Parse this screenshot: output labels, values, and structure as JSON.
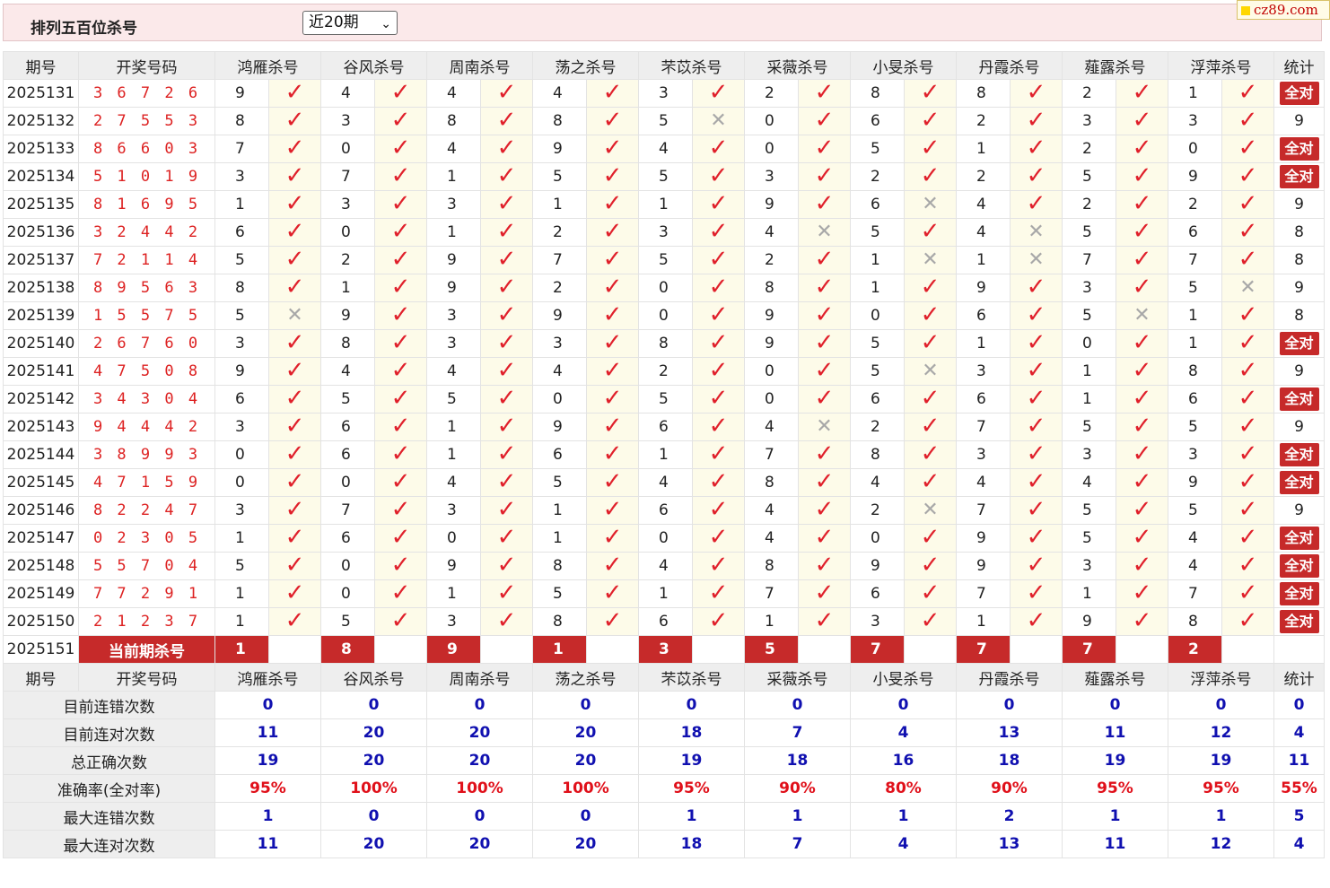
{
  "header": {
    "title": "排列五百位杀号",
    "select_value": "近20期",
    "site": "cz89.com"
  },
  "columns": {
    "issue": "期号",
    "draw": "开奖号码",
    "experts": [
      "鸿雁杀号",
      "谷风杀号",
      "周南杀号",
      "荡之杀号",
      "芣苡杀号",
      "采薇杀号",
      "小旻杀号",
      "丹霞杀号",
      "薤露杀号",
      "浮萍杀号"
    ],
    "stat": "统计"
  },
  "rows": [
    {
      "issue": "2025131",
      "draw": "3 6 7 2 6",
      "kills": [
        9,
        4,
        4,
        4,
        3,
        2,
        8,
        8,
        2,
        1
      ],
      "hits": [
        1,
        1,
        1,
        1,
        1,
        1,
        1,
        1,
        1,
        1
      ],
      "stat": "全对"
    },
    {
      "issue": "2025132",
      "draw": "2 7 5 5 3",
      "kills": [
        8,
        3,
        8,
        8,
        5,
        0,
        6,
        2,
        3,
        3
      ],
      "hits": [
        1,
        1,
        1,
        1,
        0,
        1,
        1,
        1,
        1,
        1
      ],
      "stat": "9"
    },
    {
      "issue": "2025133",
      "draw": "8 6 6 0 3",
      "kills": [
        7,
        0,
        4,
        9,
        4,
        0,
        5,
        1,
        2,
        0
      ],
      "hits": [
        1,
        1,
        1,
        1,
        1,
        1,
        1,
        1,
        1,
        1
      ],
      "stat": "全对"
    },
    {
      "issue": "2025134",
      "draw": "5 1 0 1 9",
      "kills": [
        3,
        7,
        1,
        5,
        5,
        3,
        2,
        2,
        5,
        9
      ],
      "hits": [
        1,
        1,
        1,
        1,
        1,
        1,
        1,
        1,
        1,
        1
      ],
      "stat": "全对"
    },
    {
      "issue": "2025135",
      "draw": "8 1 6 9 5",
      "kills": [
        1,
        3,
        3,
        1,
        1,
        9,
        6,
        4,
        2,
        2
      ],
      "hits": [
        1,
        1,
        1,
        1,
        1,
        1,
        0,
        1,
        1,
        1
      ],
      "stat": "9"
    },
    {
      "issue": "2025136",
      "draw": "3 2 4 4 2",
      "kills": [
        6,
        0,
        1,
        2,
        3,
        4,
        5,
        4,
        5,
        6
      ],
      "hits": [
        1,
        1,
        1,
        1,
        1,
        0,
        1,
        0,
        1,
        1
      ],
      "stat": "8"
    },
    {
      "issue": "2025137",
      "draw": "7 2 1 1 4",
      "kills": [
        5,
        2,
        9,
        7,
        5,
        2,
        1,
        1,
        7,
        7
      ],
      "hits": [
        1,
        1,
        1,
        1,
        1,
        1,
        0,
        0,
        1,
        1
      ],
      "stat": "8"
    },
    {
      "issue": "2025138",
      "draw": "8 9 5 6 3",
      "kills": [
        8,
        1,
        9,
        2,
        0,
        8,
        1,
        9,
        3,
        5
      ],
      "hits": [
        1,
        1,
        1,
        1,
        1,
        1,
        1,
        1,
        1,
        0
      ],
      "stat": "9"
    },
    {
      "issue": "2025139",
      "draw": "1 5 5 7 5",
      "kills": [
        5,
        9,
        3,
        9,
        0,
        9,
        0,
        6,
        5,
        1
      ],
      "hits": [
        0,
        1,
        1,
        1,
        1,
        1,
        1,
        1,
        0,
        1
      ],
      "stat": "8"
    },
    {
      "issue": "2025140",
      "draw": "2 6 7 6 0",
      "kills": [
        3,
        8,
        3,
        3,
        8,
        9,
        5,
        1,
        0,
        1
      ],
      "hits": [
        1,
        1,
        1,
        1,
        1,
        1,
        1,
        1,
        1,
        1
      ],
      "stat": "全对"
    },
    {
      "issue": "2025141",
      "draw": "4 7 5 0 8",
      "kills": [
        9,
        4,
        4,
        4,
        2,
        0,
        5,
        3,
        1,
        8
      ],
      "hits": [
        1,
        1,
        1,
        1,
        1,
        1,
        0,
        1,
        1,
        1
      ],
      "stat": "9"
    },
    {
      "issue": "2025142",
      "draw": "3 4 3 0 4",
      "kills": [
        6,
        5,
        5,
        0,
        5,
        0,
        6,
        6,
        1,
        6
      ],
      "hits": [
        1,
        1,
        1,
        1,
        1,
        1,
        1,
        1,
        1,
        1
      ],
      "stat": "全对"
    },
    {
      "issue": "2025143",
      "draw": "9 4 4 4 2",
      "kills": [
        3,
        6,
        1,
        9,
        6,
        4,
        2,
        7,
        5,
        5
      ],
      "hits": [
        1,
        1,
        1,
        1,
        1,
        0,
        1,
        1,
        1,
        1
      ],
      "stat": "9"
    },
    {
      "issue": "2025144",
      "draw": "3 8 9 9 3",
      "kills": [
        0,
        6,
        1,
        6,
        1,
        7,
        8,
        3,
        3,
        3
      ],
      "hits": [
        1,
        1,
        1,
        1,
        1,
        1,
        1,
        1,
        1,
        1
      ],
      "stat": "全对"
    },
    {
      "issue": "2025145",
      "draw": "4 7 1 5 9",
      "kills": [
        0,
        0,
        4,
        5,
        4,
        8,
        4,
        4,
        4,
        9
      ],
      "hits": [
        1,
        1,
        1,
        1,
        1,
        1,
        1,
        1,
        1,
        1
      ],
      "stat": "全对"
    },
    {
      "issue": "2025146",
      "draw": "8 2 2 4 7",
      "kills": [
        3,
        7,
        3,
        1,
        6,
        4,
        2,
        7,
        5,
        5
      ],
      "hits": [
        1,
        1,
        1,
        1,
        1,
        1,
        0,
        1,
        1,
        1
      ],
      "stat": "9"
    },
    {
      "issue": "2025147",
      "draw": "0 2 3 0 5",
      "kills": [
        1,
        6,
        0,
        1,
        0,
        4,
        0,
        9,
        5,
        4
      ],
      "hits": [
        1,
        1,
        1,
        1,
        1,
        1,
        1,
        1,
        1,
        1
      ],
      "stat": "全对"
    },
    {
      "issue": "2025148",
      "draw": "5 5 7 0 4",
      "kills": [
        5,
        0,
        9,
        8,
        4,
        8,
        9,
        9,
        3,
        4
      ],
      "hits": [
        1,
        1,
        1,
        1,
        1,
        1,
        1,
        1,
        1,
        1
      ],
      "stat": "全对"
    },
    {
      "issue": "2025149",
      "draw": "7 7 2 9 1",
      "kills": [
        1,
        0,
        1,
        5,
        1,
        7,
        6,
        7,
        1,
        7
      ],
      "hits": [
        1,
        1,
        1,
        1,
        1,
        1,
        1,
        1,
        1,
        1
      ],
      "stat": "全对"
    },
    {
      "issue": "2025150",
      "draw": "2 1 2 3 7",
      "kills": [
        1,
        5,
        3,
        8,
        6,
        1,
        3,
        1,
        9,
        8
      ],
      "hits": [
        1,
        1,
        1,
        1,
        1,
        1,
        1,
        1,
        1,
        1
      ],
      "stat": "全对"
    }
  ],
  "current": {
    "issue": "2025151",
    "label": "当前期杀号",
    "kills": [
      1,
      8,
      9,
      1,
      3,
      5,
      7,
      7,
      7,
      2
    ]
  },
  "summary": [
    {
      "label": "目前连错次数",
      "values": [
        "0",
        "0",
        "0",
        "0",
        "0",
        "0",
        "0",
        "0",
        "0",
        "0"
      ],
      "stat": "0",
      "color": "blue"
    },
    {
      "label": "目前连对次数",
      "values": [
        "11",
        "20",
        "20",
        "20",
        "18",
        "7",
        "4",
        "13",
        "11",
        "12"
      ],
      "stat": "4",
      "color": "blue"
    },
    {
      "label": "总正确次数",
      "values": [
        "19",
        "20",
        "20",
        "20",
        "19",
        "18",
        "16",
        "18",
        "19",
        "19"
      ],
      "stat": "11",
      "color": "blue"
    },
    {
      "label": "准确率(全对率)",
      "values": [
        "95%",
        "100%",
        "100%",
        "100%",
        "95%",
        "90%",
        "80%",
        "90%",
        "95%",
        "95%"
      ],
      "stat": "55%",
      "color": "red"
    },
    {
      "label": "最大连错次数",
      "values": [
        "1",
        "0",
        "0",
        "0",
        "1",
        "1",
        "1",
        "2",
        "1",
        "1"
      ],
      "stat": "5",
      "color": "blue"
    },
    {
      "label": "最大连对次数",
      "values": [
        "11",
        "20",
        "20",
        "20",
        "18",
        "7",
        "4",
        "13",
        "11",
        "12"
      ],
      "stat": "4",
      "color": "blue"
    }
  ],
  "symbols": {
    "hit": "✓",
    "miss": "✕"
  },
  "colors": {
    "accent": "#c62a2a",
    "hit": "#e0202b",
    "miss": "#a8a8a8",
    "stat_blue": "#1010b0",
    "stat_red": "#e0101a",
    "header_bg": "#fbe9ea"
  }
}
